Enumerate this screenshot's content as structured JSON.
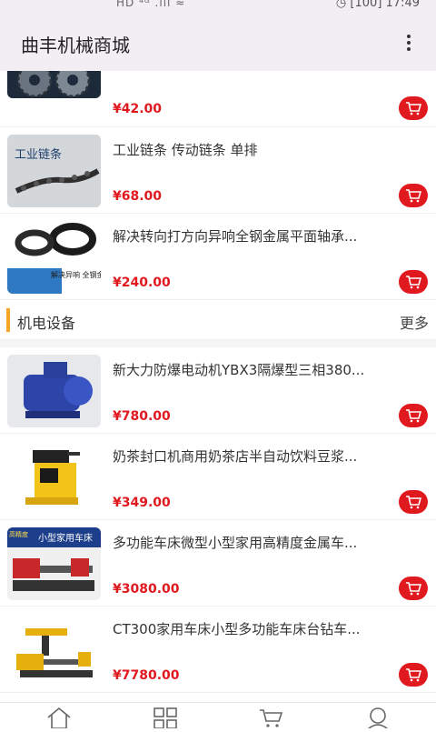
{
  "status": {
    "signal_text": "HD ⁴ᴳ .ıll ≈",
    "battery": "100",
    "time": "17:49"
  },
  "header": {
    "title": "曲丰机械商城"
  },
  "products_top": [
    {
      "name": "",
      "price": "¥42.00"
    },
    {
      "name": "工业链条 传动链条 单排",
      "price": "¥68.00"
    },
    {
      "name": "解决转向打方向异响全钢金属平面轴承...",
      "price": "¥240.00"
    }
  ],
  "section": {
    "title": "机电设备",
    "more": "更多"
  },
  "products_section": [
    {
      "name": "新大力防爆电动机YBX3隔爆型三相380...",
      "price": "¥780.00"
    },
    {
      "name": "奶茶封口机商用奶茶店半自动饮料豆浆...",
      "price": "¥349.00"
    },
    {
      "name": "多功能车床微型小型家用高精度金属车...",
      "price": "¥3080.00"
    },
    {
      "name": "CT300家用车床小型多功能车床台钻车...",
      "price": "¥7780.00"
    }
  ],
  "thumb_text": {
    "chain": "工业链条",
    "bearing": "解决异响 全钢金属轴承",
    "lathe_banner": "小型家用车床",
    "lathe_tag": "高精度"
  },
  "colors": {
    "accent": "#e0191f",
    "section_bar": "#f5a623",
    "header_bg": "#f3eef3"
  },
  "tabs": [
    "home-icon",
    "category-icon",
    "cart-icon",
    "user-icon"
  ]
}
